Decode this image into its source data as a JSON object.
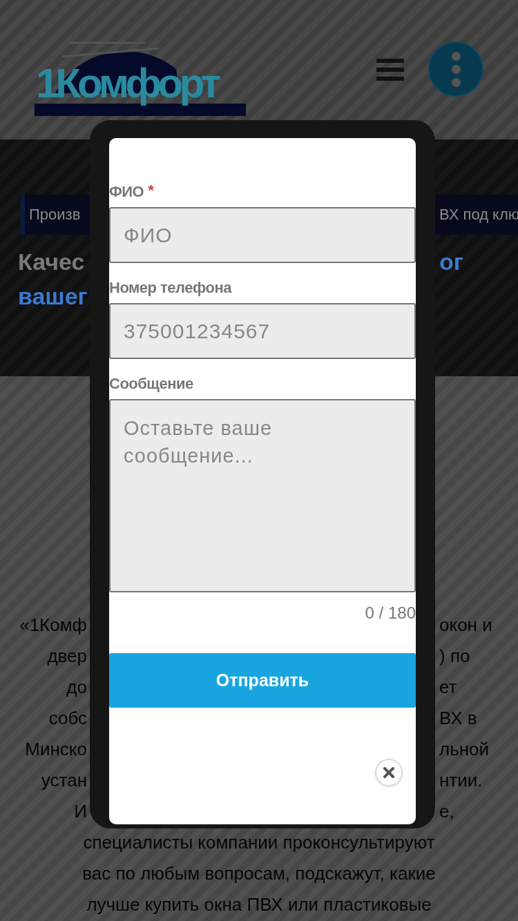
{
  "header": {
    "logo_text": "1Комфорт"
  },
  "hero": {
    "breadcrumb_left": "Произв",
    "breadcrumb_right": "ВХ под клю",
    "heading_left": "Качес",
    "heading_right": "ог",
    "heading_line2": "вашег"
  },
  "article": {
    "lines": [
      {
        "left": "«1Комф",
        "right": "окон и"
      },
      {
        "left": "двер",
        "right": ") по"
      },
      {
        "left": "до",
        "right": "ет"
      },
      {
        "left": "собс",
        "right": "ВХ в"
      },
      {
        "left": "Минско",
        "right": "льной"
      },
      {
        "left": "устан",
        "right": "нтии."
      },
      {
        "left": "И",
        "right": "е,"
      },
      {
        "full": "специалисты компании проконсультируют"
      },
      {
        "full": "вас по любым вопросам, подскажут, какие"
      },
      {
        "full": "лучше купить окна ПВХ или пластиковые"
      }
    ]
  },
  "modal": {
    "fields": [
      {
        "kind": "input",
        "label": "ФИО",
        "required_mark": "*",
        "placeholder": "ФИО"
      },
      {
        "kind": "input",
        "label": "Номер телефона",
        "placeholder": "375001234567"
      },
      {
        "kind": "textarea",
        "label": "Сообщение",
        "placeholder": "Оставьте ваше сообщение..."
      }
    ],
    "counter": "0 / 180",
    "submit": "Отправить"
  }
}
